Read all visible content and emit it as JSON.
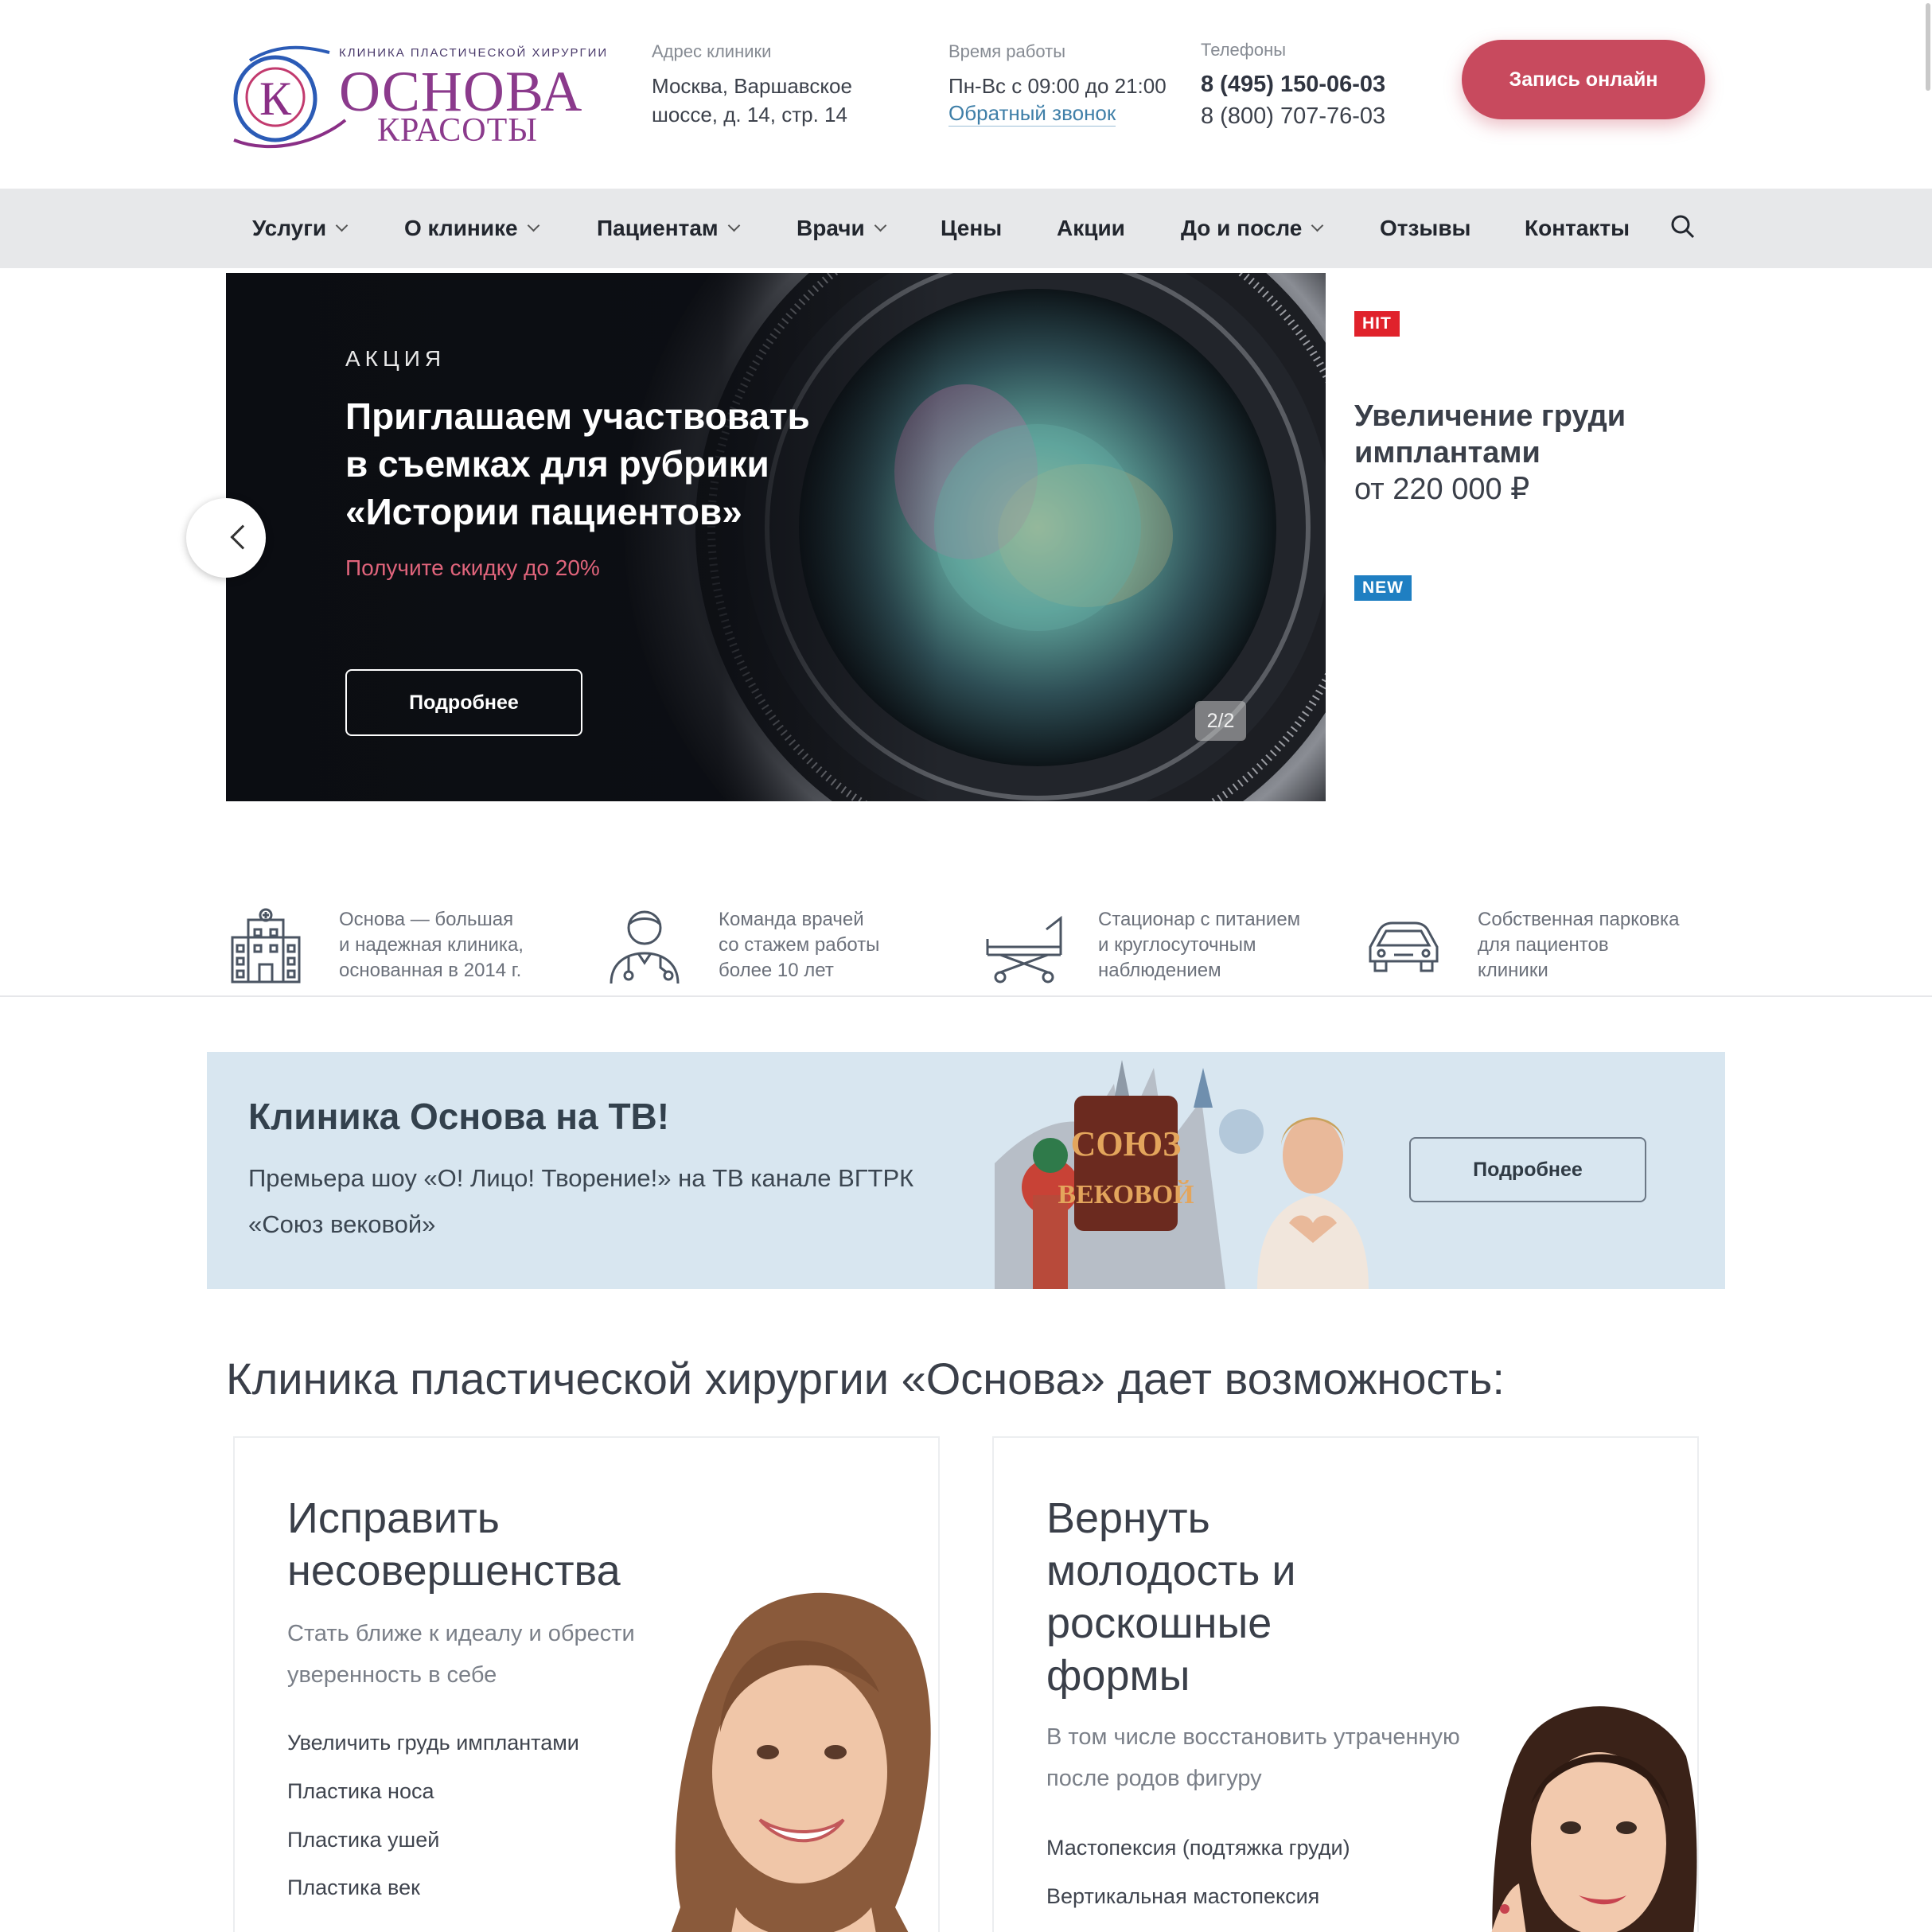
{
  "header": {
    "logo": {
      "tagline": "КЛИНИКА ПЛАСТИЧЕСКОЙ ХИРУРГИИ",
      "name_top": "ОСНОВА",
      "name_bottom": "КРАСОТЫ",
      "monogram": "К"
    },
    "address": {
      "label": "Адрес клиники",
      "line1": "Москва, Варшавское",
      "line2": "шоссе, д. 14, стр. 14"
    },
    "hours": {
      "label": "Время работы",
      "value": "Пн-Вс с 09:00 до 21:00",
      "callback": "Обратный звонок"
    },
    "phones": {
      "label": "Телефоны",
      "phone1": "8 (495) 150-06-03",
      "phone2": "8 (800) 707-76-03"
    },
    "cta": "Запись онлайн"
  },
  "nav": {
    "items": [
      {
        "label": "Услуги",
        "dropdown": true
      },
      {
        "label": "О клинике",
        "dropdown": true
      },
      {
        "label": "Пациентам",
        "dropdown": true
      },
      {
        "label": "Врачи",
        "dropdown": true
      },
      {
        "label": "Цены",
        "dropdown": false
      },
      {
        "label": "Акции",
        "dropdown": false
      },
      {
        "label": "До и после",
        "dropdown": true
      },
      {
        "label": "Отзывы",
        "dropdown": false
      },
      {
        "label": "Контакты",
        "dropdown": false
      }
    ],
    "search_icon": "search-icon"
  },
  "hero": {
    "eyebrow": "АКЦИЯ",
    "title_lines": [
      "Приглашаем участвовать",
      "в съемках для рубрики",
      "«Истории пациентов»"
    ],
    "subtitle": "Получите скидку до 20%",
    "button": "Подробнее",
    "counter": "2/2"
  },
  "promo": {
    "badge_hit": "HIT",
    "badge_new": "NEW",
    "title_lines": [
      "Увеличение груди",
      "имплантами",
      "от 220 000 ₽"
    ],
    "colors": {
      "hit": "#e0222b",
      "new": "#1f7fc2"
    }
  },
  "features": [
    {
      "icon": "clinic-building-icon",
      "lines": [
        "Основа — большая",
        "и надежная клиника,",
        "основанная в 2014 г."
      ]
    },
    {
      "icon": "doctor-icon",
      "lines": [
        "Команда врачей",
        "со стажем работы",
        "более 10 лет"
      ]
    },
    {
      "icon": "hospital-bed-icon",
      "lines": [
        "Стационар с питанием",
        "и круглосуточным",
        "наблюдением"
      ]
    },
    {
      "icon": "car-icon",
      "lines": [
        "Собственная парковка",
        "для пациентов",
        "клиники"
      ]
    }
  ],
  "tv": {
    "title": "Клиника Основа на ТВ!",
    "text_line1": "Премьера шоу «О! Лицо! Творение!» на ТВ канале ВГТРК",
    "text_line2": "«Союз вековой»",
    "button": "Подробнее",
    "logo_line1": "СОЮЗ",
    "logo_line2": "ВЕКОВОЙ"
  },
  "section": {
    "title": "Клиника пластической хирургии «Основа» дает возможность:",
    "cards": [
      {
        "title_lines": [
          "Исправить",
          "несовершенства"
        ],
        "subtitle_lines": [
          "Стать ближе к идеалу и обрести",
          "уверенность в себе"
        ],
        "links": [
          "Увеличить грудь имплантами",
          "Пластика носа",
          "Пластика ушей",
          "Пластика век"
        ]
      },
      {
        "title_lines": [
          "Вернуть",
          "молодость и",
          "роскошные",
          "формы"
        ],
        "subtitle_lines": [
          "В том числе восстановить утраченную",
          "после родов фигуру"
        ],
        "links": [
          "Мастопексия (подтяжка груди)",
          "Вертикальная мастопексия"
        ]
      }
    ]
  },
  "colors": {
    "accent": "#c84a5e",
    "nav_bg": "#e7e8ea",
    "tv_bg": "#d8e6f0",
    "hero_bg": "#111319"
  }
}
